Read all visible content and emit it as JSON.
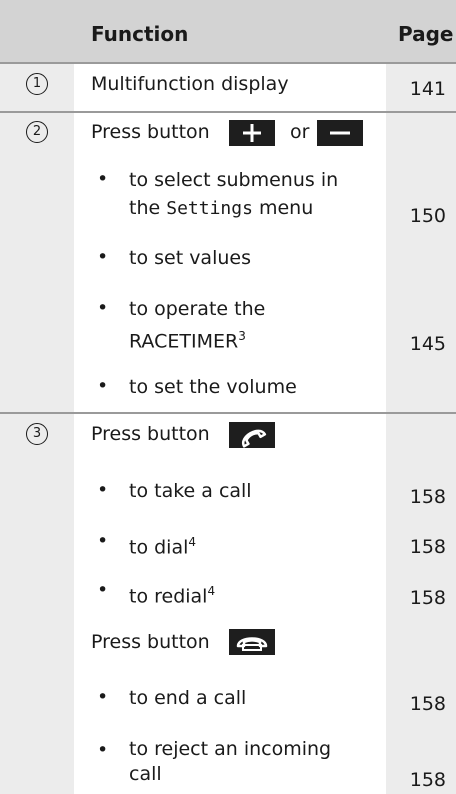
{
  "header": {
    "function": "Function",
    "page": "Page"
  },
  "rows": [
    {
      "num": "1",
      "title": "Multifunction display",
      "page": "141"
    },
    {
      "num": "2",
      "title_a": "Press button",
      "title_or": "or",
      "items": [
        {
          "line1": "to select submenus in",
          "line2_pre": "the ",
          "line2_mono": "Settings",
          "line2_post": " menu",
          "page": "150"
        },
        {
          "line1": "to set values"
        },
        {
          "line1": "to operate the",
          "line2": "RACETIMER",
          "sup": "3",
          "page": "145"
        },
        {
          "line1": "to set the volume"
        }
      ]
    },
    {
      "num": "3",
      "title_a": "Press button",
      "items_a": [
        {
          "text": "to take a call",
          "page": "158"
        },
        {
          "text": "to dial",
          "sup": "4",
          "page": "158"
        },
        {
          "text": "to redial",
          "sup": "4",
          "page": "158"
        }
      ],
      "title_b": "Press button",
      "items_b": [
        {
          "text": "to end a call",
          "page": "158"
        },
        {
          "line1": "to reject an incoming",
          "line2": "call",
          "page": "158"
        }
      ]
    }
  ],
  "icons": {
    "plus": "plus-button-icon",
    "minus": "minus-button-icon",
    "phone_accept": "phone-accept-icon",
    "phone_end": "phone-end-icon"
  }
}
